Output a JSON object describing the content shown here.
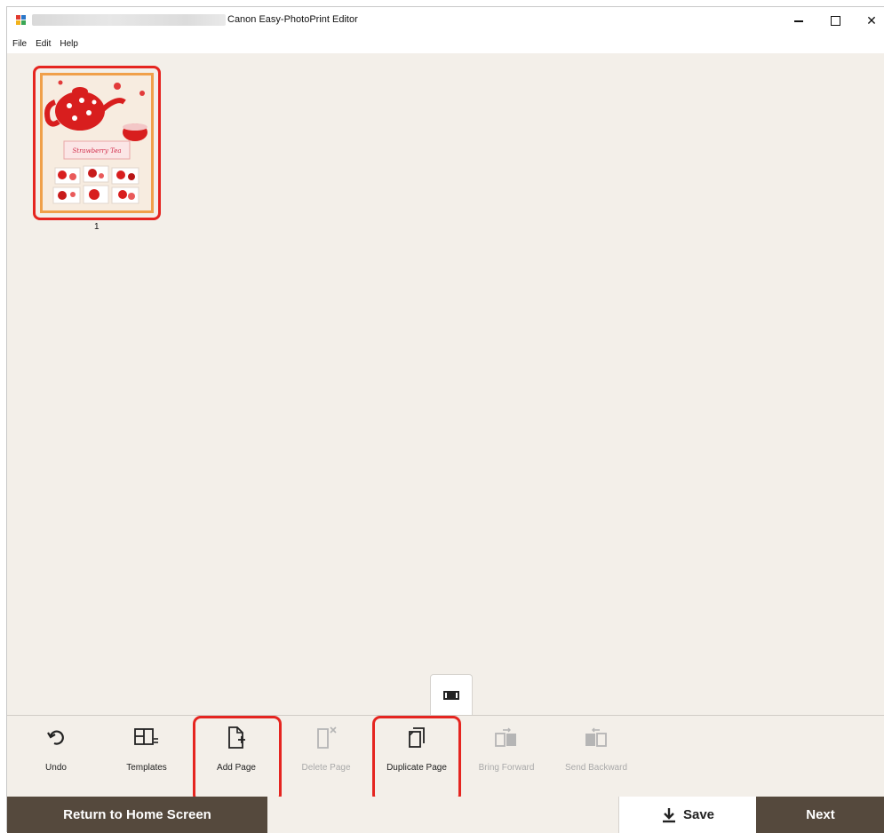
{
  "window": {
    "title": "Canon Easy-PhotoPrint Editor",
    "min_icon": "minimize-icon",
    "max_icon": "maximize-icon",
    "close_icon": "close-icon"
  },
  "menu": {
    "items": [
      "File",
      "Edit",
      "Help"
    ]
  },
  "pages": {
    "thumbnails": [
      {
        "number": "1",
        "selected": true,
        "poster_text": "Strawberry Tea"
      }
    ]
  },
  "toolbar": {
    "items": [
      {
        "label": "Undo",
        "icon": "undo-icon",
        "enabled": true
      },
      {
        "label": "Templates",
        "icon": "templates-icon",
        "enabled": true
      },
      {
        "label": "Add Page",
        "icon": "add-page-icon",
        "enabled": true,
        "highlighted": true
      },
      {
        "label": "Delete Page",
        "icon": "delete-page-icon",
        "enabled": false
      },
      {
        "label": "Duplicate Page",
        "icon": "duplicate-page-icon",
        "enabled": true,
        "highlighted": true
      },
      {
        "label": "Bring Forward",
        "icon": "bring-forward-icon",
        "enabled": false
      },
      {
        "label": "Send Backward",
        "icon": "send-backward-icon",
        "enabled": false
      }
    ]
  },
  "bottom": {
    "home_label": "Return to Home Screen",
    "save_label": "Save",
    "next_label": "Next"
  },
  "colors": {
    "accent_dark": "#55493d",
    "highlight_red": "#e52520",
    "workspace_bg": "#f3efe9"
  }
}
